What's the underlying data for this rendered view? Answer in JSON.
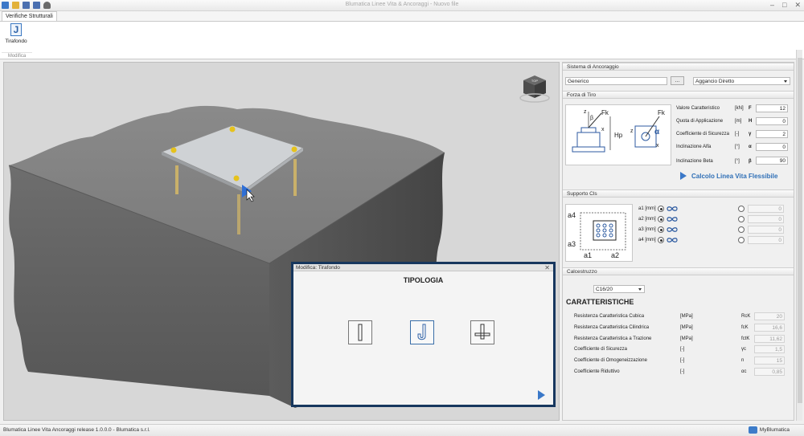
{
  "window": {
    "title": "Blumatica Linee Vita & Ancoraggi - Nuovo file",
    "controls": {
      "minimize": "–",
      "maximize": "□",
      "close": "✕"
    },
    "qat_icons": [
      "ribbon-menu-icon",
      "open-folder-icon",
      "save-icon",
      "save-as-icon",
      "user-icon"
    ]
  },
  "ribbon": {
    "tab": "Verifiche Strutturali",
    "button_label": "Tirafondo",
    "group_label": "Modifica"
  },
  "viewcube": {
    "label": "TOP"
  },
  "dialog": {
    "title": "Modifica: Tirafondo",
    "close": "✕",
    "heading": "TIPOLOGIA",
    "selected": "j-anchor"
  },
  "panel": {
    "sistema": {
      "header": "Sistema di Ancoraggio",
      "field_value": "Generico",
      "browse_label": "...",
      "dropdown_value": "Aggancio Diretto"
    },
    "forza": {
      "header": "Forza di Tiro",
      "sketch_labels": {
        "fk": "Fk",
        "beta": "β",
        "z": "z",
        "x": "x",
        "hp": "Hp",
        "fk2": "Fk",
        "alpha": "α",
        "z2": "z",
        "x2": "x"
      },
      "rows": [
        {
          "label": "Valore Caratteristico",
          "unit": "[kN]",
          "symbol": "F",
          "value": "12"
        },
        {
          "label": "Quota di Applicazione",
          "unit": "[m]",
          "symbol": "H",
          "value": "0"
        },
        {
          "label": "Coefficiente di Sicurezza",
          "unit": "[-]",
          "symbol": "γ",
          "value": "2"
        },
        {
          "label": "Inclinazione Alfa",
          "unit": "[°]",
          "symbol": "α",
          "value": "0"
        },
        {
          "label": "Inclinazione Beta",
          "unit": "[°]",
          "symbol": "β",
          "value": "90"
        }
      ],
      "calc_label": "Calcolo Linea Vita Flessibile"
    },
    "supporto": {
      "header": "Supporto Cls",
      "sketch_labels": {
        "a4": "a4",
        "a3": "a3",
        "a1": "a1",
        "a2": "a2"
      },
      "rows": [
        {
          "label": "a1 [mm]",
          "value": "0"
        },
        {
          "label": "a2 [mm]",
          "value": "0"
        },
        {
          "label": "a3 [mm]",
          "value": "0"
        },
        {
          "label": "a4 [mm]",
          "value": "0"
        }
      ]
    },
    "calcestruzzo": {
      "header": "Calcestruzzo",
      "class_value": "C16/20",
      "title": "CARATTERISTICHE",
      "rows": [
        {
          "label": "Resistenza Caratteristica Cubica",
          "unit": "[MPa]",
          "symbol": "RcK",
          "value": "20"
        },
        {
          "label": "Resistenza Caratteristica Cilindrica",
          "unit": "[MPa]",
          "symbol": "fcK",
          "value": "16,6"
        },
        {
          "label": "Resistenza Caratteristica a Trazione",
          "unit": "[MPa]",
          "symbol": "fctK",
          "value": "11,62"
        },
        {
          "label": "Coefficiente di Sicurezza",
          "unit": "[-]",
          "symbol": "γc",
          "value": "1,5"
        },
        {
          "label": "Coefficiente di Omogeneizzazione",
          "unit": "[-]",
          "symbol": "n",
          "value": "15"
        },
        {
          "label": "Coefficiente Riduttivo",
          "unit": "[-]",
          "symbol": "αc",
          "value": "0,85"
        }
      ]
    }
  },
  "status": {
    "text": "Blumatica Linee Vita  Ancoraggi release 1.0.0.0 - Blumatica s.r.l.",
    "account": "MyBlumatica"
  },
  "colors": {
    "accent": "#3a78c8",
    "dialog_border": "#17375e",
    "concrete": "#6a6a6a",
    "anchor": "#c9b06a"
  }
}
